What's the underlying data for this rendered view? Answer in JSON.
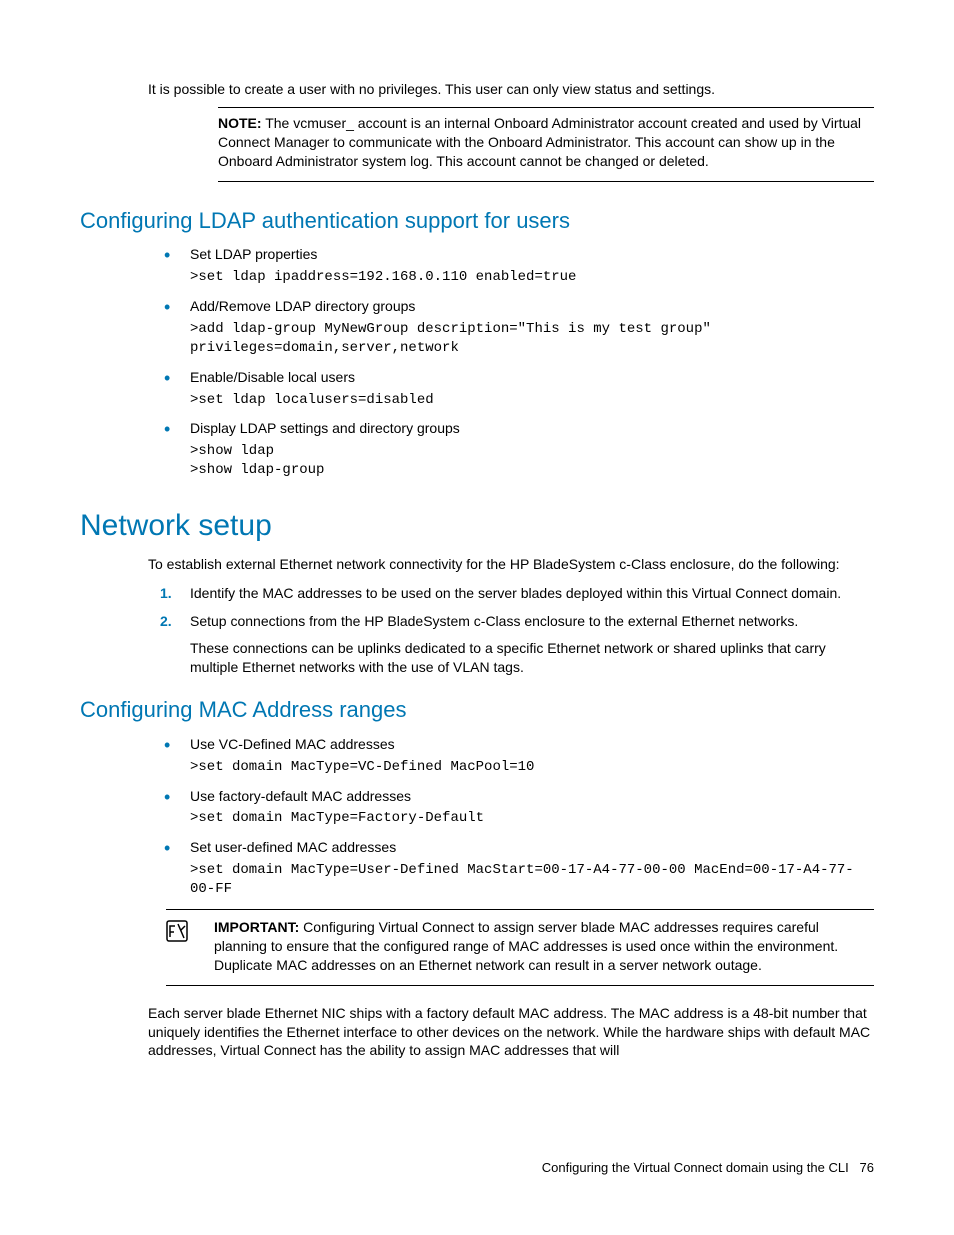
{
  "intro": "It is possible to create a user with no privileges. This user can only view status and settings.",
  "note": {
    "label": "NOTE:",
    "text": " The vcmuser_ account is an internal Onboard Administrator account created and used by Virtual Connect Manager to communicate with the Onboard Administrator. This account can show up in the Onboard Administrator system log. This account cannot be changed or deleted."
  },
  "ldap": {
    "heading": "Configuring LDAP authentication support for users",
    "items": [
      {
        "title": "Set LDAP properties",
        "code": ">set ldap ipaddress=192.168.0.110 enabled=true"
      },
      {
        "title": "Add/Remove LDAP directory groups",
        "code": ">add ldap-group MyNewGroup description=\"This is my test group\" privileges=domain,server,network"
      },
      {
        "title": "Enable/Disable local users",
        "code": ">set ldap localusers=disabled"
      },
      {
        "title": "Display LDAP settings and directory groups",
        "code": ">show ldap\n>show ldap-group"
      }
    ]
  },
  "network": {
    "heading": "Network setup",
    "intro": "To establish external Ethernet network connectivity for the HP BladeSystem c-Class enclosure, do the following:",
    "steps": [
      {
        "text": "Identify the MAC addresses to be used on the server blades deployed within this Virtual Connect domain."
      },
      {
        "text": "Setup connections from the HP BladeSystem c-Class enclosure to the external Ethernet networks.",
        "sub": "These connections can be uplinks dedicated to a specific Ethernet network or shared uplinks that carry multiple Ethernet networks with the use of VLAN tags."
      }
    ]
  },
  "mac": {
    "heading": "Configuring MAC Address ranges",
    "items": [
      {
        "title": "Use VC-Defined MAC addresses",
        "code": ">set domain MacType=VC-Defined MacPool=10"
      },
      {
        "title": "Use factory-default MAC addresses",
        "code": ">set domain MacType=Factory-Default"
      },
      {
        "title": "Set user-defined MAC addresses",
        "code": ">set domain MacType=User-Defined MacStart=00-17-A4-77-00-00 MacEnd=00-17-A4-77-00-FF"
      }
    ],
    "important": {
      "label": "IMPORTANT:",
      "text": " Configuring Virtual Connect to assign server blade MAC addresses requires careful planning to ensure that the configured range of MAC addresses is used once within the environment. Duplicate MAC addresses on an Ethernet network can result in a server network outage."
    },
    "closing": "Each server blade Ethernet NIC ships with a factory default MAC address. The MAC address is a 48-bit number that uniquely identifies the Ethernet interface to other devices on the network. While the hardware ships with default MAC addresses, Virtual Connect has the ability to assign MAC addresses that will"
  },
  "footer": {
    "text": "Configuring the Virtual Connect domain using the CLI",
    "page": "76"
  }
}
